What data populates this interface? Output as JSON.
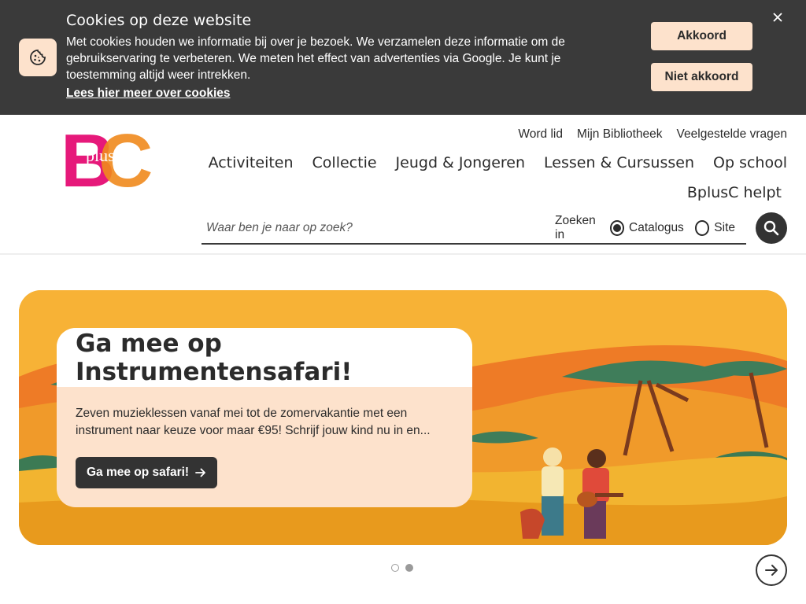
{
  "cookie_banner": {
    "title": "Cookies op deze website",
    "text": "Met cookies houden we informatie bij over je bezoek. We verzamelen deze informatie om de gebruikservaring te verbeteren. We meten het effect van advertenties via Google. Je kunt je toestemming altijd weer intrekken.",
    "link_label": "Lees hier meer over cookies",
    "accept_label": "Akkoord",
    "decline_label": "Niet akkoord",
    "close_icon": "close-icon",
    "icon": "cookie-icon"
  },
  "logo": {
    "main": "BC",
    "small": "plus"
  },
  "utility_nav": [
    "Word lid",
    "Mijn Bibliotheek",
    "Veelgestelde vragen"
  ],
  "main_nav": [
    "Activiteiten",
    "Collectie",
    "Jeugd & Jongeren",
    "Lessen & Cursussen",
    "Op school",
    "BplusC helpt"
  ],
  "search": {
    "placeholder": "Waar ben je naar op zoek?",
    "scope_label": "Zoeken in",
    "options": [
      "Catalogus",
      "Site"
    ],
    "selected": "Catalogus"
  },
  "hero": {
    "title": "Ga mee op Instrumentensafari!",
    "text": "Zeven muzieklessen vanaf mei tot de zomervakantie met een instrument naar keuze voor maar €95! Schrijf jouw kind nu in en...",
    "button_label": "Ga mee op safari!"
  },
  "carousel": {
    "slides": 2,
    "active": 1
  },
  "colors": {
    "banner_bg": "#3a3a3a",
    "accent_peach": "#fde2cc",
    "dark_button": "#333333",
    "logo_pink": "#e6197a",
    "logo_orange": "#f08a1e",
    "hero_orange": "#f5a623"
  }
}
